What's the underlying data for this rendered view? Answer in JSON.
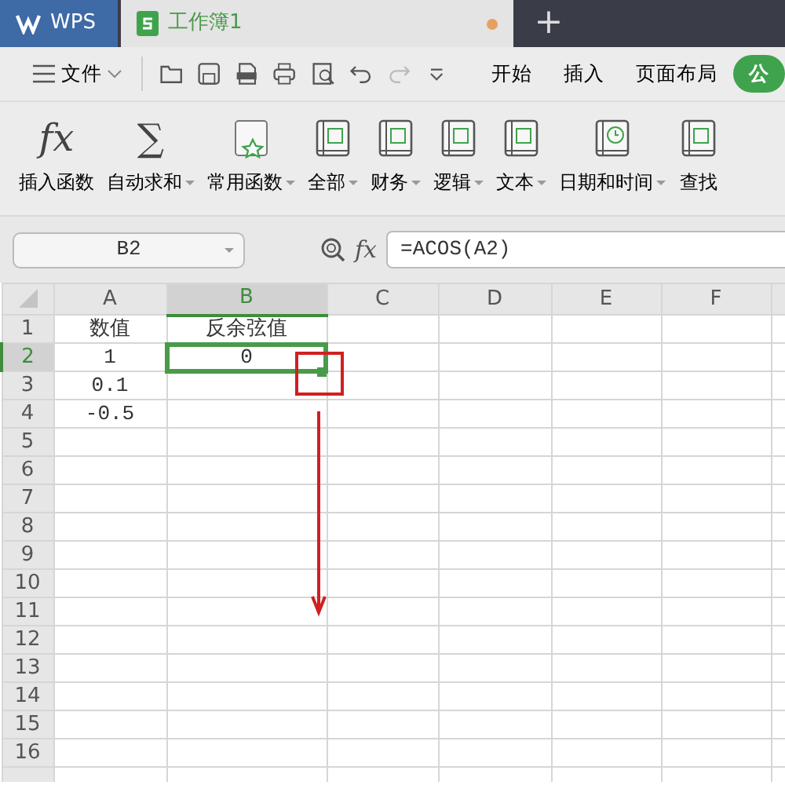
{
  "app_tabs": [
    {
      "label": "WPS",
      "kind": "home",
      "selected": false,
      "unsaved": false
    },
    {
      "label": "工作簿1",
      "kind": "sheet",
      "selected": true,
      "unsaved": true
    }
  ],
  "new_tab": "+",
  "menu": {
    "file": "文件",
    "tabs": [
      {
        "label": "开始",
        "selected": false
      },
      {
        "label": "插入",
        "selected": false
      },
      {
        "label": "页面布局",
        "selected": false
      },
      {
        "label": "公",
        "selected": true
      }
    ]
  },
  "ribbon": [
    {
      "label": "插入函数",
      "kind": "fx",
      "glyph": "fx",
      "dropdown": false
    },
    {
      "label": "自动求和",
      "kind": "sum",
      "glyph": "∑",
      "dropdown": true
    },
    {
      "label": "常用函数",
      "kind": "star",
      "dropdown": true
    },
    {
      "label": "全部",
      "kind": "book",
      "dropdown": true
    },
    {
      "label": "财务",
      "kind": "book",
      "dropdown": true
    },
    {
      "label": "逻辑",
      "kind": "book",
      "dropdown": true
    },
    {
      "label": "文本",
      "kind": "book",
      "dropdown": true
    },
    {
      "label": "日期和时间",
      "kind": "clock",
      "dropdown": true
    },
    {
      "label": "查找",
      "kind": "book",
      "dropdown": false
    }
  ],
  "name_box": "B2",
  "formula_label": "fx",
  "formula": "=ACOS(A2)",
  "columns": [
    {
      "label": "A",
      "selected": false
    },
    {
      "label": "B",
      "selected": true
    },
    {
      "label": "C",
      "selected": false
    },
    {
      "label": "D",
      "selected": false
    },
    {
      "label": "E",
      "selected": false
    },
    {
      "label": "F",
      "selected": false
    }
  ],
  "rows": [
    {
      "label": "1",
      "selected": false,
      "cells": [
        {
          "text": "数值",
          "selected": false
        },
        {
          "text": "反余弦值",
          "selected": false
        }
      ]
    },
    {
      "label": "2",
      "selected": true,
      "cells": [
        {
          "text": "1",
          "selected": false
        },
        {
          "text": "0",
          "selected": true
        }
      ]
    },
    {
      "label": "3",
      "selected": false,
      "cells": [
        {
          "text": "0.1",
          "selected": false
        }
      ]
    },
    {
      "label": "4",
      "selected": false,
      "cells": [
        {
          "text": "-0.5",
          "selected": false
        }
      ]
    },
    {
      "label": "5",
      "selected": false
    },
    {
      "label": "6",
      "selected": false
    },
    {
      "label": "7",
      "selected": false
    },
    {
      "label": "8",
      "selected": false
    },
    {
      "label": "9",
      "selected": false
    },
    {
      "label": "10",
      "selected": false
    },
    {
      "label": "11",
      "selected": false
    },
    {
      "label": "12",
      "selected": false
    },
    {
      "label": "13",
      "selected": false
    },
    {
      "label": "14",
      "selected": false
    },
    {
      "label": "15",
      "selected": false
    },
    {
      "label": "16",
      "selected": false
    }
  ],
  "annotations": [
    {
      "kind": "box"
    },
    {
      "kind": "arrow"
    }
  ]
}
